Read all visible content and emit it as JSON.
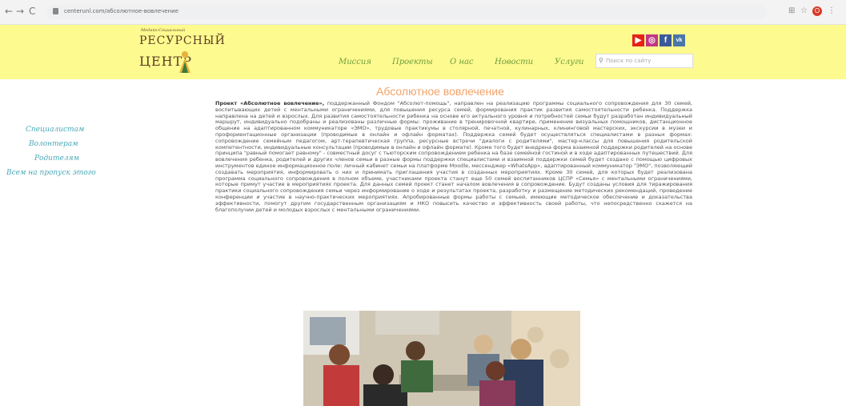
{
  "browser": {
    "back": "←",
    "forward": "→",
    "reload": "C",
    "url": "centerunl.com/абсолютное-вовлечение",
    "profile": "О"
  },
  "header": {
    "logo_small": "Медико-Социальный",
    "logo_line1": "РЕСУРСНЫЙ",
    "logo_line2": "ЦЕНТР",
    "menu": [
      {
        "label": "Миссия"
      },
      {
        "label": "Проекты"
      },
      {
        "label": "О нас"
      },
      {
        "label": "Новости"
      },
      {
        "label": "Услуги"
      }
    ],
    "search_placeholder": "Поиск по сайту",
    "social": [
      {
        "icon": "youtube-icon",
        "glyph": "▶",
        "color": "#e62117"
      },
      {
        "icon": "instagram-icon",
        "glyph": "◎",
        "color": "#c13584"
      },
      {
        "icon": "facebook-icon",
        "glyph": "f",
        "color": "#3b5998"
      },
      {
        "icon": "vk-icon",
        "glyph": "vk",
        "color": "#4a76a8"
      }
    ]
  },
  "sidebar": [
    {
      "label": "Специалистам"
    },
    {
      "label": "Волонтерам"
    },
    {
      "label": "Родителям"
    },
    {
      "label": "Всем на пропуск этого"
    }
  ],
  "main": {
    "title": "Абсолютное вовлечение",
    "lead": "Проект «Абсолютное вовлечение»,",
    "body": " поддержанный Фондом \"Абсолют-помощь\", направлен на реализацию программы социального сопровождения для 30 семей, воспитывающих детей с ментальными ограничениями, для повышения ресурса семей, формирования практик развития самостоятельности ребенка. Поддержка направлена на детей и взрослых. Для развития самостоятельности ребенка на основе его актуального уровня и потребностей семьи будут разработан индивидуальный маршрут, индивидуально подобраны и реализованы различные формы: проживание в тренировочной квартире, применение визуальных помощников, дистанционное общение на адаптированном коммуникаторе «ЭМО», трудовые практикумы в столярной, печатной, кулинарных, клининговой мастерских, экскурсии в музеи и профориентационные организации (проводимые в онлайн и офлайн форматах). Поддержка семей будет осуществляться специалистами в разных формах: сопровождение семейным педагогом, арт-терапевтическая группа, ресурсные встречи \"диалоги с родителями\", мастер-классы для повышения родительской компетентности, индивидуальные консультации (проводимые в онлайн и офлайн формате). Кроме того будет внедрена форма взаимной поддержки родителей на основе принципа \"равный помогает равному\" - совместный досуг с тьюторским сопровождением ребенка на базе семейной гостиной и в ходе адаптированных путешествий. Для вовлечения ребенка, родителей и других членов семьи в разные формы поддержки специалистами и взаимной поддержки семей будет создано с помощью цифровых инструментов единое информационное поле: личный кабинет семьи на платформе Moodle, мессенджер «WhatsApp», адаптированный коммуникатор \"ЭМО\", позволяющий создавать мероприятия, информировать о них и принимать приглашения участия в созданных мероприятиях. Кроме 30 семей, для которых будет реализована программа социального сопровождения в полном объеме, участниками проекта станут еще 50 семей воспитанников ЦСПР «Семья» с ментальными ограничениями, которые примут участие в мероприятиях проекта. Для данных семей проект станет началом вовлечения в сопровождение. Будут созданы условия для тиражирования практики социального сопровождения семьи через информирование о ходе и результатах проекта, разработку и размещение методических рекомендаций, проведение конференции и участие в научно-практических мероприятиях. Апробированные формы работы с семьей, имеющие методическое обеспечение и доказательства эффективности, помогут другим государственным организациям и НКО повысить качество и эффективность своей работы, что непосредственно скажется на благополучии детей и молодых взрослых с ментальными ограничениями."
  },
  "colors": {
    "header_bg": "#fdfa90",
    "menu": "#6e9d3a",
    "sidebar": "#4aa8b6",
    "title": "#f0a46a"
  }
}
